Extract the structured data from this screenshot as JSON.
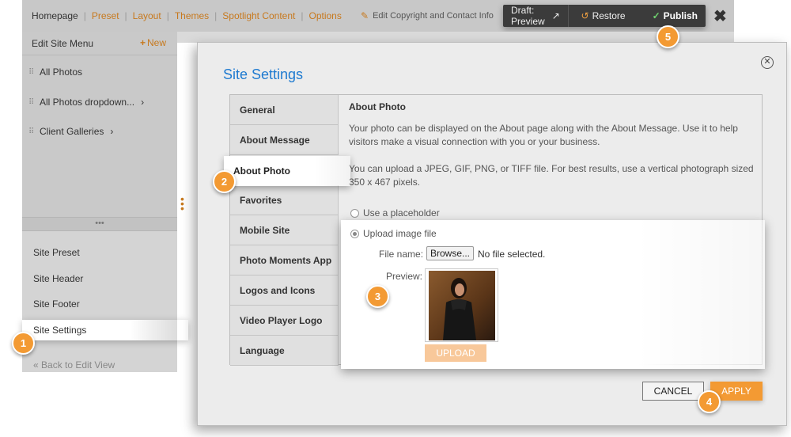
{
  "topbar": {
    "nav": [
      "Homepage",
      "Preset",
      "Layout",
      "Themes",
      "Spotlight Content",
      "Options"
    ],
    "edit_copyright": "Edit Copyright and Contact Info",
    "draft_preview": "Draft: Preview",
    "restore": "Restore",
    "publish": "Publish"
  },
  "sidebar": {
    "menu_title": "Edit Site Menu",
    "new_label": "New",
    "menu_items": [
      "All Photos",
      "All Photos dropdown...",
      "Client Galleries"
    ],
    "links": [
      "Site Preset",
      "Site Header",
      "Site Footer",
      "Site Settings"
    ],
    "back": "Back to Edit View"
  },
  "modal": {
    "title": "Site Settings",
    "tabs": [
      "General",
      "About Message",
      "About Photo",
      "Favorites",
      "Mobile Site",
      "Photo Moments App",
      "Logos and Icons",
      "Video Player Logo",
      "Language"
    ],
    "active_tab": "About Photo",
    "content_title": "About Photo",
    "para1": "Your photo can be displayed on the About page along with the About Message. Use it to help visitors make a visual connection with you or your business.",
    "para2": "You can upload a JPEG, GIF, PNG, or TIFF file. For best results, use a vertical photograph sized 350 x 467 pixels.",
    "option_placeholder": "Use a placeholder",
    "option_upload": "Upload image file",
    "file_name_label": "File name:",
    "browse": "Browse...",
    "no_file": "No file selected.",
    "preview_label": "Preview:",
    "upload": "UPLOAD",
    "cancel": "CANCEL",
    "apply": "APPLY"
  },
  "badges": [
    "1",
    "2",
    "3",
    "4",
    "5"
  ],
  "colors": {
    "accent": "#f39a33",
    "title_blue": "#1e7ad0",
    "nav_orange": "#c7791e"
  }
}
